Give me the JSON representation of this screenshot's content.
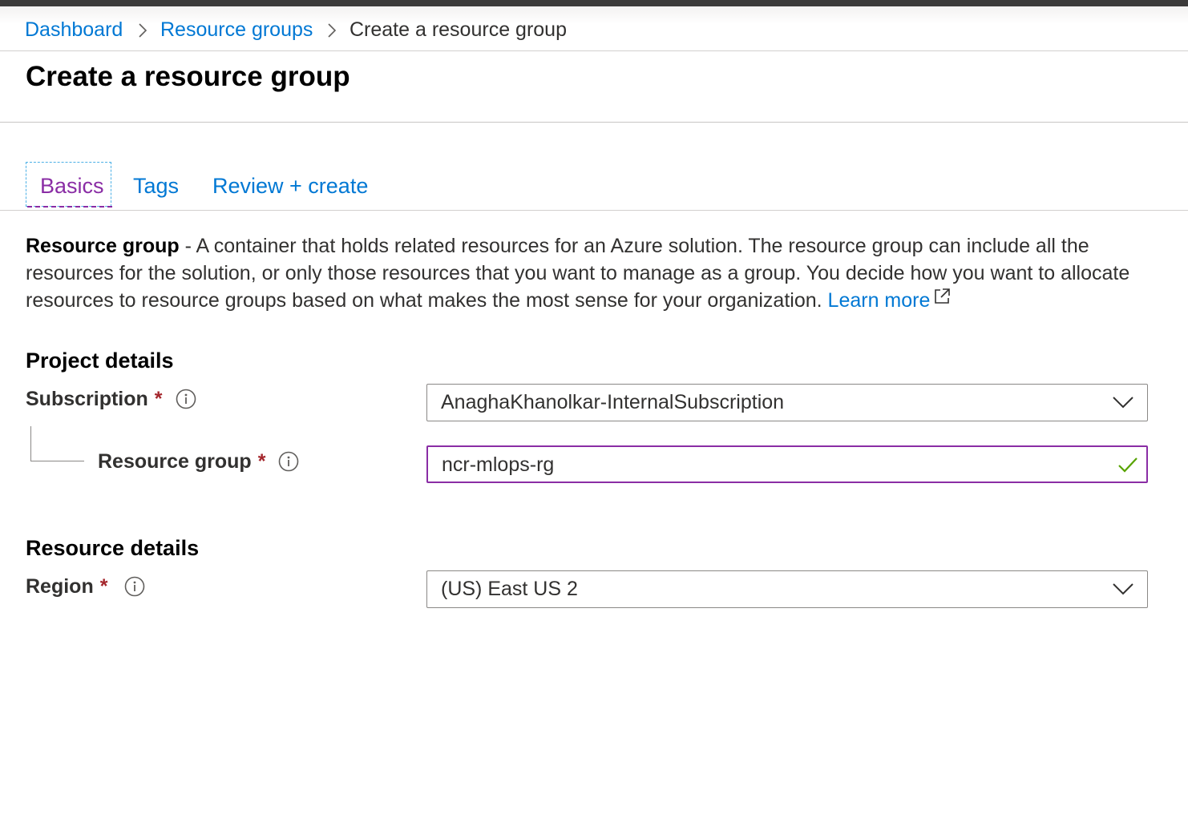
{
  "breadcrumb": {
    "items": [
      "Dashboard",
      "Resource groups"
    ],
    "current": "Create a resource group"
  },
  "page": {
    "title": "Create a resource group"
  },
  "tabs": [
    {
      "label": "Basics",
      "active": true
    },
    {
      "label": "Tags",
      "active": false
    },
    {
      "label": "Review + create",
      "active": false
    }
  ],
  "description": {
    "term": "Resource group",
    "text": " - A container that holds related resources for an Azure solution. The resource group can include all the resources for the solution, or only those resources that you want to manage as a group. You decide how you want to allocate resources to resource groups based on what makes the most sense for your organization.",
    "link": "Learn more"
  },
  "project_details": {
    "heading": "Project details",
    "subscription": {
      "label": "Subscription",
      "required_mark": "*",
      "value": "AnaghaKhanolkar-InternalSubscription"
    },
    "resource_group": {
      "label": "Resource group",
      "required_mark": "*",
      "value": "ncr-mlops-rg",
      "valid": true
    }
  },
  "resource_details": {
    "heading": "Resource details",
    "region": {
      "label": "Region",
      "required_mark": "*",
      "value": "(US) East US 2"
    }
  },
  "icons": {
    "separator": "chevron-right-icon",
    "info": "info-icon",
    "dropdown": "chevron-down-icon",
    "valid": "checkmark-icon",
    "external": "external-link-icon"
  },
  "colors": {
    "link": "#0078d4",
    "active_tab": "#8a2da5",
    "focus_border": "#8a2da5",
    "required": "#a4262c",
    "valid_check": "#57a300"
  }
}
